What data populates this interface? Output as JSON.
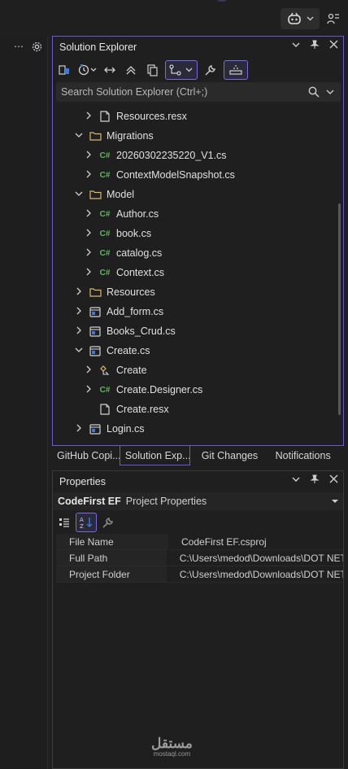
{
  "solution_explorer": {
    "title": "Solution Explorer",
    "search_placeholder": "Search Solution Explorer (Ctrl+;)",
    "tree": [
      {
        "label": "Resources.resx",
        "icon": "file-icon",
        "expand": "collapsed",
        "level": 2
      },
      {
        "label": "Migrations",
        "icon": "folder-icon",
        "expand": "expanded",
        "level": 1
      },
      {
        "label": "20260302235220_V1.cs",
        "icon": "csharp-icon",
        "expand": "collapsed",
        "level": 2
      },
      {
        "label": "ContextModelSnapshot.cs",
        "icon": "csharp-icon",
        "expand": "collapsed",
        "level": 2
      },
      {
        "label": "Model",
        "icon": "folder-icon",
        "expand": "expanded",
        "level": 1
      },
      {
        "label": "Author.cs",
        "icon": "csharp-icon",
        "expand": "collapsed",
        "level": 2
      },
      {
        "label": "book.cs",
        "icon": "csharp-icon",
        "expand": "collapsed",
        "level": 2
      },
      {
        "label": "catalog.cs",
        "icon": "csharp-icon",
        "expand": "collapsed",
        "level": 2
      },
      {
        "label": "Context.cs",
        "icon": "csharp-icon",
        "expand": "collapsed",
        "level": 2
      },
      {
        "label": "Resources",
        "icon": "folder-icon",
        "expand": "collapsed",
        "level": 1
      },
      {
        "label": "Add_form.cs",
        "icon": "form-icon",
        "expand": "collapsed",
        "level": 1
      },
      {
        "label": "Books_Crud.cs",
        "icon": "form-icon",
        "expand": "collapsed",
        "level": 1
      },
      {
        "label": "Create.cs",
        "icon": "form-icon",
        "expand": "expanded",
        "level": 1
      },
      {
        "label": "Create",
        "icon": "class-icon",
        "expand": "collapsed",
        "level": 2
      },
      {
        "label": "Create.Designer.cs",
        "icon": "csharp-icon",
        "expand": "collapsed",
        "level": 2
      },
      {
        "label": "Create.resx",
        "icon": "file-icon",
        "expand": "none",
        "level": 2
      },
      {
        "label": "Login.cs",
        "icon": "form-icon",
        "expand": "collapsed",
        "level": 1
      }
    ]
  },
  "tabs": [
    "GitHub Copi...",
    "Solution Exp...",
    "Git Changes",
    "Notifications"
  ],
  "properties": {
    "title": "Properties",
    "object_name": "CodeFirst EF",
    "object_type": "Project Properties",
    "rows": [
      {
        "name": "File Name",
        "value": "CodeFirst EF.csproj"
      },
      {
        "name": "Full Path",
        "value": "C:\\Users\\medod\\Downloads\\DOT NET"
      },
      {
        "name": "Project Folder",
        "value": "C:\\Users\\medod\\Downloads\\DOT NET"
      }
    ]
  },
  "watermark": {
    "line1": "مستقل",
    "line2": "mostaql.com"
  },
  "colors": {
    "accent": "#6a5acd",
    "csharp": "#5fb760",
    "folder": "#d7b96a"
  }
}
